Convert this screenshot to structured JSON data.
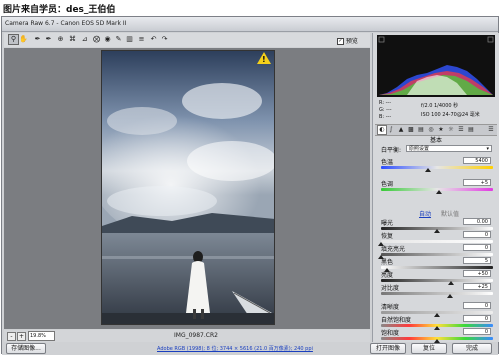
{
  "banner": {
    "text": "图片来自学员：des_王伯伯"
  },
  "window": {
    "title": "Camera Raw 6.7  -  Canon EOS 5D Mark II"
  },
  "toolbar": {
    "tools": [
      {
        "name": "zoom-tool-icon",
        "glyph": "🔍"
      },
      {
        "name": "hand-tool-icon",
        "glyph": "✋"
      },
      {
        "name": "white-balance-tool-icon",
        "glyph": "⁄"
      },
      {
        "name": "color-sampler-tool-icon",
        "glyph": "⁄"
      },
      {
        "name": "targeted-adjustment-tool-icon",
        "glyph": "⊕"
      },
      {
        "name": "crop-tool-icon",
        "glyph": "⌗"
      },
      {
        "name": "straighten-tool-icon",
        "glyph": "⊿"
      },
      {
        "name": "spot-removal-tool-icon",
        "glyph": "⊙"
      },
      {
        "name": "red-eye-tool-icon",
        "glyph": "◉"
      },
      {
        "name": "adjustment-brush-icon",
        "glyph": "✎"
      },
      {
        "name": "graduated-filter-icon",
        "glyph": "▥"
      },
      {
        "name": "preferences-icon",
        "glyph": "≣"
      },
      {
        "name": "rotate-ccw-icon",
        "glyph": "↶"
      },
      {
        "name": "rotate-cw-icon",
        "glyph": "↷"
      }
    ],
    "preview_label": "预览",
    "preview_checked": "✓"
  },
  "status": {
    "zoom_minus": "-",
    "zoom_plus": "+",
    "zoom": "19.8%",
    "filename": "IMG_0987.CR2"
  },
  "bottom": {
    "save_label": "存储图像...",
    "workflow_link": "Adobe RGB (1998); 8 位; 3744 × 5616 (21.0 百万像素); 240 ppi",
    "open_label": "打开图像",
    "reset_label": "复位",
    "done_label": "完成"
  },
  "readouts": {
    "r": "R:  ---",
    "g": "G:  ---",
    "b": "B:  ---",
    "aperture": "f/2.0   1/4000 秒",
    "iso": "ISO 100   24-70@24 毫米"
  },
  "panel": {
    "title": "基本",
    "wb_label": "白平衡:",
    "wb_value": "原照设置",
    "temp_label": "色温",
    "temp_value": "5400",
    "temp_pos": 0.42,
    "tint_label": "色调",
    "tint_value": "+5",
    "tint_pos": 0.52,
    "auto_label": "自动",
    "default_label": "默认值",
    "exposure_label": "曝光",
    "exposure_value": "0.00",
    "exposure_pos": 0.5,
    "recovery_label": "恢复",
    "recovery_value": "0",
    "recovery_pos": 0.0,
    "fill_label": "填充亮光",
    "fill_value": "0",
    "fill_pos": 0.0,
    "blacks_label": "黑色",
    "blacks_value": "5",
    "blacks_pos": 0.05,
    "brightness_label": "亮度",
    "brightness_value": "+50",
    "brightness_pos": 0.625,
    "contrast_label": "对比度",
    "contrast_value": "+25",
    "contrast_pos": 0.62,
    "clarity_label": "清晰度",
    "clarity_value": "0",
    "clarity_pos": 0.5,
    "vibrance_label": "自然饱和度",
    "vibrance_value": "0",
    "vibrance_pos": 0.5,
    "saturation_label": "饱和度",
    "saturation_value": "0",
    "saturation_pos": 0.5
  },
  "colors": {
    "panel_bg": "#d6d8db",
    "canvas_bg": "#7b7d81",
    "warning": "#f4d01a",
    "link": "#1a3fbf"
  },
  "photo_warning_icon": "warning-triangle-icon"
}
